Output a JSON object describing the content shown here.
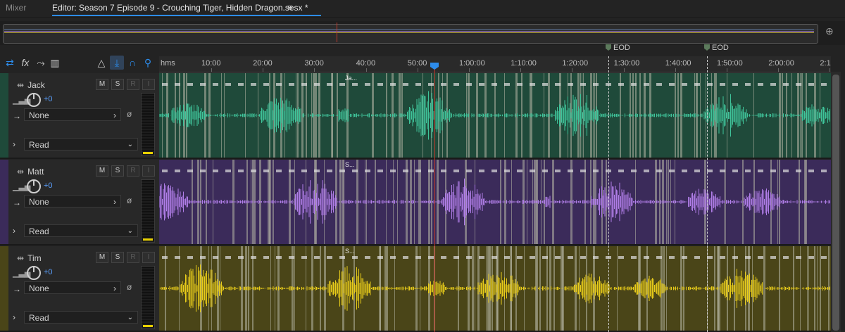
{
  "tabs": {
    "mixer": "Mixer",
    "editor": "Editor: Season 7 Episode 9 - Crouching Tiger, Hidden Dragon.sesx *",
    "menu": "≡"
  },
  "ruler": {
    "unit": "hms",
    "ticks": [
      "10:00",
      "20:00",
      "30:00",
      "40:00",
      "50:00",
      "1:00:00",
      "1:10:00",
      "1:20:00",
      "1:30:00",
      "1:40:00",
      "1:50:00",
      "2:00:00",
      "2:1"
    ]
  },
  "markers": [
    "EOD",
    "EOD"
  ],
  "tracks": [
    {
      "name": "Jack",
      "mute": "M",
      "solo": "S",
      "rec": "R",
      "input": "I",
      "volume": "+0",
      "route": "None",
      "automation": "Read",
      "color": "#1f4a3a",
      "wave": "#3fc49a",
      "clip_label": "Ja...",
      "meter_level": 0.04
    },
    {
      "name": "Matt",
      "mute": "M",
      "solo": "S",
      "rec": "R",
      "input": "I",
      "volume": "+0",
      "route": "None",
      "automation": "Read",
      "color": "#3b2b5a",
      "wave": "#b07ee8",
      "clip_label": "S...",
      "meter_level": 0.04
    },
    {
      "name": "Tim",
      "mute": "M",
      "solo": "S",
      "rec": "R",
      "input": "I",
      "volume": "+0",
      "route": "None",
      "automation": "Read",
      "color": "#4a4518",
      "wave": "#e8cc1a",
      "clip_label": "S...",
      "meter_level": 0.04
    }
  ],
  "toolbar_icons": [
    "swap-icon",
    "fx-icon",
    "send-icon",
    "eq-bars-icon",
    "metronome-icon",
    "loop-record-icon",
    "magnet-icon",
    "pin-icon"
  ]
}
